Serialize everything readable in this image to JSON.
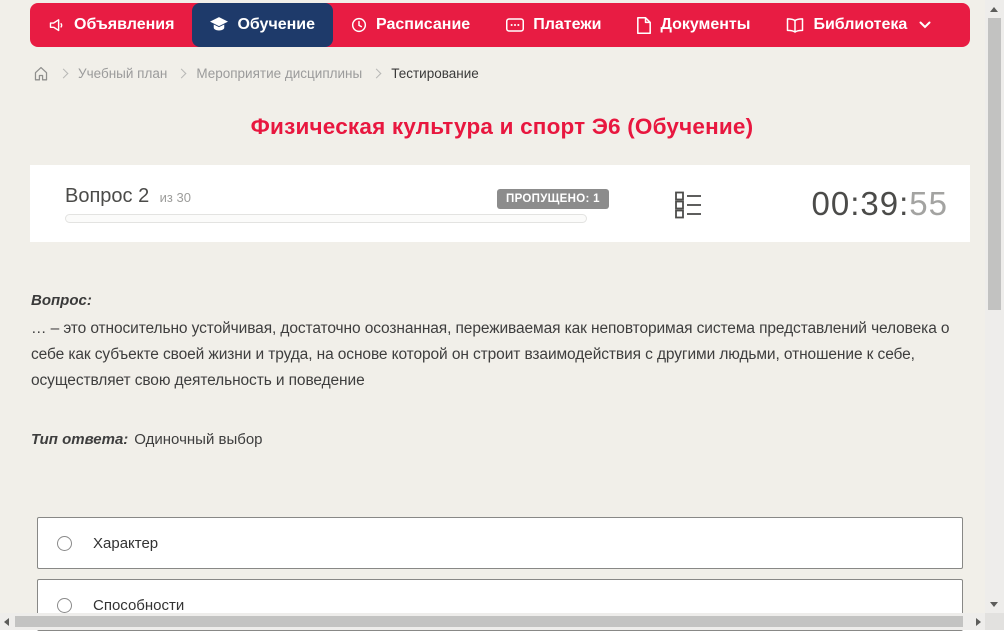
{
  "colors": {
    "nav_red": "#e81c43",
    "nav_active_navy": "#1e3a6a",
    "title_red": "#e8173f",
    "badge_gray": "#8c8c8c"
  },
  "nav": {
    "items": [
      {
        "label": "Объявления",
        "icon": "megaphone-icon",
        "active": false
      },
      {
        "label": "Обучение",
        "icon": "graduation-cap-icon",
        "active": true
      },
      {
        "label": "Расписание",
        "icon": "clock-icon",
        "active": false
      },
      {
        "label": "Платежи",
        "icon": "credit-card-icon",
        "active": false
      },
      {
        "label": "Документы",
        "icon": "document-icon",
        "active": false
      },
      {
        "label": "Библиотека",
        "icon": "book-icon",
        "active": false,
        "has_dropdown": true
      }
    ]
  },
  "breadcrumb": {
    "items": [
      "Учебный план",
      "Мероприятие дисциплины",
      "Тестирование"
    ]
  },
  "page": {
    "title": "Физическая культура и спорт Э6 (Обучение)"
  },
  "question_header": {
    "question_label": "Вопрос 2",
    "of_label": "из 30",
    "skipped_badge": "ПРОПУЩЕНО: 1",
    "progress_percent": 0,
    "timer_main": "00:39:",
    "timer_seconds": "55"
  },
  "question": {
    "label": "Вопрос:",
    "text": "… – это относительно устойчивая, достаточно осознанная, переживаемая как неповторимая система представлений человека о себе как субъекте своей жизни и труда, на основе которой он строит взаимодействия с другими людьми, отношение к себе, осуществляет свою деятельность и поведение",
    "answer_type_label": "Тип ответа:",
    "answer_type_value": "Одиночный выбор"
  },
  "options": [
    {
      "label": "Характер",
      "selected": false
    },
    {
      "label": "Способности",
      "selected": false
    }
  ]
}
